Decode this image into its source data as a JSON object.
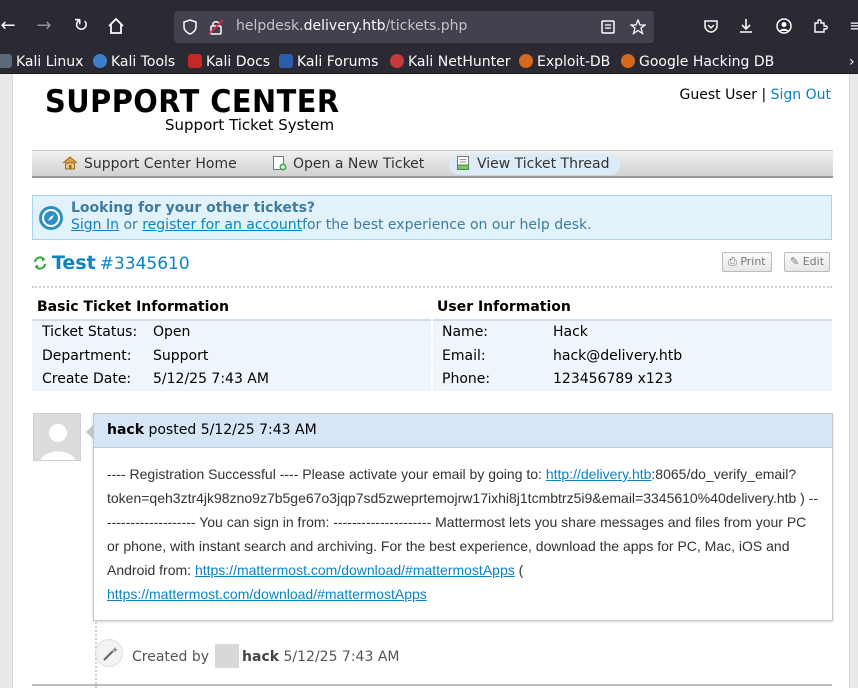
{
  "browser": {
    "url_prefix": "helpdesk.",
    "url_domain": "delivery.htb",
    "url_path": "/tickets.php",
    "bookmarks": [
      "Kali Linux",
      "Kali Tools",
      "Kali Docs",
      "Kali Forums",
      "Kali NetHunter",
      "Exploit-DB",
      "Google Hacking DB"
    ],
    "overflow_glyph": "›"
  },
  "header": {
    "logo_title": "SUPPORT CENTER",
    "logo_subtitle": "Support Ticket System",
    "guest_label": "Guest User",
    "separator": "|",
    "sign_out": "Sign Out"
  },
  "nav": {
    "items": [
      "Support Center Home",
      "Open a New Ticket",
      "View Ticket Thread"
    ]
  },
  "notice": {
    "title": "Looking for your other tickets?",
    "sign_in": "Sign In",
    "or": "or",
    "register": "register for an account",
    "rest": "for the best experience on our help desk."
  },
  "ticket": {
    "subject": "Test",
    "number": "#3345610",
    "print_label": "Print",
    "edit_label": "Edit"
  },
  "basic_info": {
    "heading": "Basic Ticket Information",
    "rows": [
      {
        "label": "Ticket Status:",
        "value": "Open"
      },
      {
        "label": "Department:",
        "value": "Support"
      },
      {
        "label": "Create Date:",
        "value": "5/12/25 7:43 AM"
      }
    ]
  },
  "user_info": {
    "heading": "User Information",
    "rows": [
      {
        "label": "Name:",
        "value": "Hack"
      },
      {
        "label": "Email:",
        "value": "hack@delivery.htb"
      },
      {
        "label": "Phone:",
        "value": "123456789 x123"
      }
    ]
  },
  "message": {
    "author": "hack",
    "posted": "posted",
    "date": "5/12/25 7:43 AM",
    "body_1": "---- Registration Successful ---- Please activate your email by going to: ",
    "link_1": "http://delivery.htb",
    "body_2": ":8065/do_verify_email?token=qeh3ztr4jk98zno9z7b5ge67o3jqp7sd5zweprtemojrw17ixhi8j1tcmbtrz5i9&email=3345610%40delivery.htb ) --------------------- You can sign in from: --------------------- Mattermost lets you share messages and files from your PC or phone, with instant search and archiving. For the best experience, download the apps for PC, Mac, iOS and Android from: ",
    "link_2": "https://mattermost.com/download/#mattermostApps",
    "body_3": " ( ",
    "link_3": "https://mattermost.com/download/#mattermostApps"
  },
  "event": {
    "created_by": "Created by",
    "user": "hack",
    "date": "5/12/25 7:43 AM"
  }
}
